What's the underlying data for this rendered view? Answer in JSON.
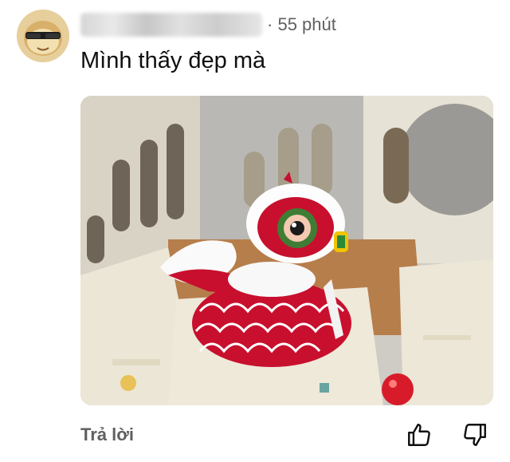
{
  "comment": {
    "author_avatar": "avatar-icon",
    "time_sep": "·",
    "time_ago": "55 phút",
    "text": "Mình thấy đẹp mà",
    "attachment": "photo"
  },
  "actions": {
    "reply_label": "Trả lời",
    "like_icon": "thumbs-up-icon",
    "dislike_icon": "thumbs-down-icon"
  },
  "colors": {
    "text_primary": "#0f0f0f",
    "text_secondary": "#606060",
    "background": "#ffffff"
  }
}
